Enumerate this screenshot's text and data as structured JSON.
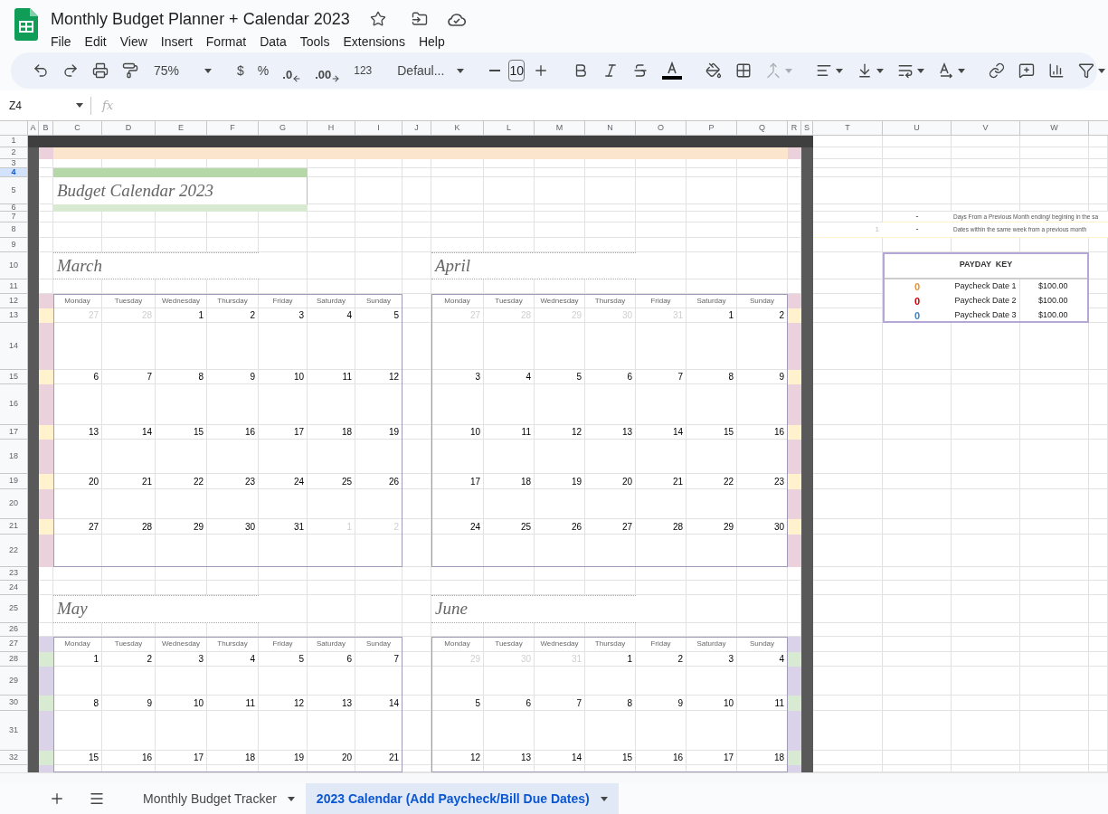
{
  "document": {
    "title": "Monthly Budget Planner + Calendar 2023"
  },
  "menu": [
    "File",
    "Edit",
    "View",
    "Insert",
    "Format",
    "Data",
    "Tools",
    "Extensions",
    "Help"
  ],
  "toolbar": {
    "zoom": "75%",
    "currency": "$",
    "percent": "%",
    "decrease_decimal": ".0",
    "increase_decimal": ".00",
    "number_format": "123",
    "font": "Defaul...",
    "font_size": "10"
  },
  "formula_bar": {
    "name_box": "Z4",
    "fx": "fx"
  },
  "columns": [
    "A",
    "B",
    "C",
    "D",
    "E",
    "F",
    "G",
    "H",
    "I",
    "J",
    "K",
    "L",
    "M",
    "N",
    "O",
    "P",
    "Q",
    "R",
    "S",
    "T",
    "U",
    "V",
    "W"
  ],
  "rows": [
    {
      "label": "1",
      "selected": false
    },
    {
      "label": "2",
      "selected": false
    },
    {
      "label": "3",
      "selected": false
    },
    {
      "label": "4",
      "selected": true
    },
    {
      "label": "5",
      "selected": false
    },
    {
      "label": "6",
      "selected": false
    },
    {
      "label": "7",
      "selected": false
    },
    {
      "label": "8",
      "selected": false
    },
    {
      "label": "9",
      "selected": false
    },
    {
      "label": "10",
      "selected": false
    },
    {
      "label": "11",
      "selected": false
    },
    {
      "label": "12",
      "selected": false
    },
    {
      "label": "13",
      "selected": false
    },
    {
      "label": "14",
      "selected": false
    },
    {
      "label": "15",
      "selected": false
    },
    {
      "label": "16",
      "selected": false
    },
    {
      "label": "17",
      "selected": false
    },
    {
      "label": "18",
      "selected": false
    },
    {
      "label": "19",
      "selected": false
    },
    {
      "label": "20",
      "selected": false
    },
    {
      "label": "21",
      "selected": false
    },
    {
      "label": "22",
      "selected": false
    },
    {
      "label": "23",
      "selected": false
    },
    {
      "label": "24",
      "selected": false
    },
    {
      "label": "25",
      "selected": false
    },
    {
      "label": "26",
      "selected": false
    },
    {
      "label": "27",
      "selected": false
    },
    {
      "label": "28",
      "selected": false
    },
    {
      "label": "29",
      "selected": false
    },
    {
      "label": "30",
      "selected": false
    },
    {
      "label": "31",
      "selected": false
    },
    {
      "label": "32",
      "selected": false
    }
  ],
  "sheet": {
    "title": "Budget Calendar 2023",
    "legend": [
      {
        "marker": "-",
        "text": "Days From a Previous Month ending/ begining in the sa"
      },
      {
        "count": "1",
        "marker": "-",
        "text": "Dates within the same week from a previous month"
      }
    ],
    "payday_key": {
      "title": "PAYDAY  KEY",
      "items": [
        {
          "marker": "0",
          "color": "#e69138",
          "label": "Paycheck Date 1",
          "amount": "$100.00"
        },
        {
          "marker": "0",
          "color": "#cc0000",
          "label": "Paycheck Date 2",
          "amount": "$100.00"
        },
        {
          "marker": "0",
          "color": "#3d85c6",
          "label": "Paycheck Date 3",
          "amount": "$100.00"
        }
      ]
    },
    "calendars": [
      {
        "month": "March",
        "weekdays": [
          "Monday",
          "Tuesday",
          "Wednesday",
          "Thursday",
          "Friday",
          "Saturday",
          "Sunday"
        ],
        "weeks": [
          [
            {
              "day": "27",
              "muted": true
            },
            {
              "day": "28",
              "muted": true
            },
            {
              "day": "1",
              "muted": false
            },
            {
              "day": "2",
              "muted": false
            },
            {
              "day": "3",
              "muted": false
            },
            {
              "day": "4",
              "muted": false
            },
            {
              "day": "5",
              "muted": false
            }
          ],
          [
            {
              "day": "6",
              "muted": false
            },
            {
              "day": "7",
              "muted": false
            },
            {
              "day": "8",
              "muted": false
            },
            {
              "day": "9",
              "muted": false
            },
            {
              "day": "10",
              "muted": false
            },
            {
              "day": "11",
              "muted": false
            },
            {
              "day": "12",
              "muted": false
            }
          ],
          [
            {
              "day": "13",
              "muted": false
            },
            {
              "day": "14",
              "muted": false
            },
            {
              "day": "15",
              "muted": false
            },
            {
              "day": "16",
              "muted": false
            },
            {
              "day": "17",
              "muted": false
            },
            {
              "day": "18",
              "muted": false
            },
            {
              "day": "19",
              "muted": false
            }
          ],
          [
            {
              "day": "20",
              "muted": false
            },
            {
              "day": "21",
              "muted": false
            },
            {
              "day": "22",
              "muted": false
            },
            {
              "day": "23",
              "muted": false
            },
            {
              "day": "24",
              "muted": false
            },
            {
              "day": "25",
              "muted": false
            },
            {
              "day": "26",
              "muted": false
            }
          ],
          [
            {
              "day": "27",
              "muted": false
            },
            {
              "day": "28",
              "muted": false
            },
            {
              "day": "29",
              "muted": false
            },
            {
              "day": "30",
              "muted": false
            },
            {
              "day": "31",
              "muted": false
            },
            {
              "day": "1",
              "muted": true
            },
            {
              "day": "2",
              "muted": true
            }
          ]
        ]
      },
      {
        "month": "April",
        "weekdays": [
          "Monday",
          "Tuesday",
          "Wednesday",
          "Thursday",
          "Friday",
          "Saturday",
          "Sunday"
        ],
        "weeks": [
          [
            {
              "day": "27",
              "muted": true
            },
            {
              "day": "28",
              "muted": true
            },
            {
              "day": "29",
              "muted": true
            },
            {
              "day": "30",
              "muted": true
            },
            {
              "day": "31",
              "muted": true
            },
            {
              "day": "1",
              "muted": false
            },
            {
              "day": "2",
              "muted": false
            }
          ],
          [
            {
              "day": "3",
              "muted": false
            },
            {
              "day": "4",
              "muted": false
            },
            {
              "day": "5",
              "muted": false
            },
            {
              "day": "6",
              "muted": false
            },
            {
              "day": "7",
              "muted": false
            },
            {
              "day": "8",
              "muted": false
            },
            {
              "day": "9",
              "muted": false
            }
          ],
          [
            {
              "day": "10",
              "muted": false
            },
            {
              "day": "11",
              "muted": false
            },
            {
              "day": "12",
              "muted": false
            },
            {
              "day": "13",
              "muted": false
            },
            {
              "day": "14",
              "muted": false
            },
            {
              "day": "15",
              "muted": false
            },
            {
              "day": "16",
              "muted": false
            }
          ],
          [
            {
              "day": "17",
              "muted": false
            },
            {
              "day": "18",
              "muted": false
            },
            {
              "day": "19",
              "muted": false
            },
            {
              "day": "20",
              "muted": false
            },
            {
              "day": "21",
              "muted": false
            },
            {
              "day": "22",
              "muted": false
            },
            {
              "day": "23",
              "muted": false
            }
          ],
          [
            {
              "day": "24",
              "muted": false
            },
            {
              "day": "25",
              "muted": false
            },
            {
              "day": "26",
              "muted": false
            },
            {
              "day": "27",
              "muted": false
            },
            {
              "day": "28",
              "muted": false
            },
            {
              "day": "29",
              "muted": false
            },
            {
              "day": "30",
              "muted": false
            }
          ]
        ]
      },
      {
        "month": "May",
        "weekdays": [
          "Monday",
          "Tuesday",
          "Wednesday",
          "Thursday",
          "Friday",
          "Saturday",
          "Sunday"
        ],
        "weeks": [
          [
            {
              "day": "1",
              "muted": false
            },
            {
              "day": "2",
              "muted": false
            },
            {
              "day": "3",
              "muted": false
            },
            {
              "day": "4",
              "muted": false
            },
            {
              "day": "5",
              "muted": false
            },
            {
              "day": "6",
              "muted": false
            },
            {
              "day": "7",
              "muted": false
            }
          ],
          [
            {
              "day": "8",
              "muted": false
            },
            {
              "day": "9",
              "muted": false
            },
            {
              "day": "10",
              "muted": false
            },
            {
              "day": "11",
              "muted": false
            },
            {
              "day": "12",
              "muted": false
            },
            {
              "day": "13",
              "muted": false
            },
            {
              "day": "14",
              "muted": false
            }
          ],
          [
            {
              "day": "15",
              "muted": false
            },
            {
              "day": "16",
              "muted": false
            },
            {
              "day": "17",
              "muted": false
            },
            {
              "day": "18",
              "muted": false
            },
            {
              "day": "19",
              "muted": false
            },
            {
              "day": "20",
              "muted": false
            },
            {
              "day": "21",
              "muted": false
            }
          ]
        ]
      },
      {
        "month": "June",
        "weekdays": [
          "Monday",
          "Tuesday",
          "Wednesday",
          "Thursday",
          "Friday",
          "Saturday",
          "Sunday"
        ],
        "weeks": [
          [
            {
              "day": "29",
              "muted": true
            },
            {
              "day": "30",
              "muted": true
            },
            {
              "day": "31",
              "muted": true
            },
            {
              "day": "1",
              "muted": false
            },
            {
              "day": "2",
              "muted": false
            },
            {
              "day": "3",
              "muted": false
            },
            {
              "day": "4",
              "muted": false
            }
          ],
          [
            {
              "day": "5",
              "muted": false
            },
            {
              "day": "6",
              "muted": false
            },
            {
              "day": "7",
              "muted": false
            },
            {
              "day": "8",
              "muted": false
            },
            {
              "day": "9",
              "muted": false
            },
            {
              "day": "10",
              "muted": false
            },
            {
              "day": "11",
              "muted": false
            }
          ],
          [
            {
              "day": "12",
              "muted": false
            },
            {
              "day": "13",
              "muted": false
            },
            {
              "day": "14",
              "muted": false
            },
            {
              "day": "15",
              "muted": false
            },
            {
              "day": "16",
              "muted": false
            },
            {
              "day": "17",
              "muted": false
            },
            {
              "day": "18",
              "muted": false
            }
          ]
        ]
      }
    ]
  },
  "tabs": [
    {
      "label": "Monthly Budget Tracker",
      "selected": false
    },
    {
      "label": "2023 Calendar (Add Paycheck/Bill Due Dates)",
      "selected": true
    }
  ]
}
